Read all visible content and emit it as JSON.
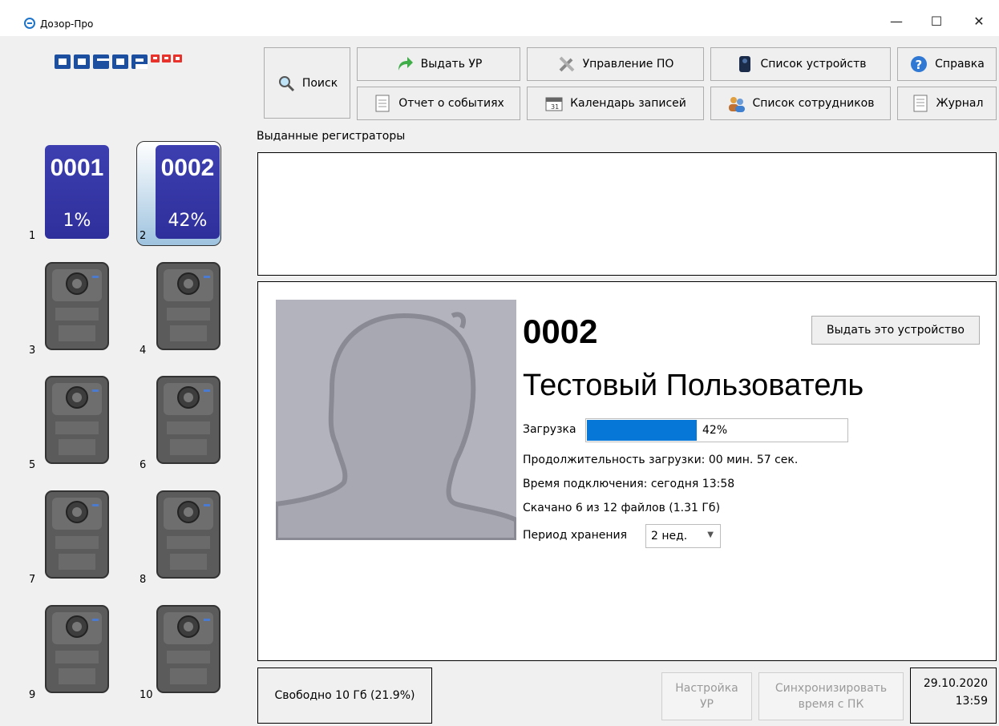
{
  "window": {
    "title": "Дозор-Про",
    "controls": {
      "minimize": "—",
      "maximize": "☐",
      "close": "✕"
    }
  },
  "logo": {
    "text_main": "DOZOR",
    "text_pro": "PRO",
    "colors": {
      "main": "#1c4fa0",
      "pro": "#e8322c"
    }
  },
  "toolbar": {
    "search": "Поиск",
    "issue": "Выдать УР",
    "events_report": "Отчет о событиях",
    "software": "Управление ПО",
    "calendar": "Календарь записей",
    "devices": "Список устройств",
    "employees": "Список сотрудников",
    "help": "Справка",
    "journal": "Журнал"
  },
  "devices": [
    {
      "slot": "1",
      "code": "0001",
      "charge": "1%"
    },
    {
      "slot": "2",
      "code": "0002",
      "charge": "42%"
    },
    {
      "slot": "3"
    },
    {
      "slot": "4"
    },
    {
      "slot": "5"
    },
    {
      "slot": "6"
    },
    {
      "slot": "7"
    },
    {
      "slot": "8"
    },
    {
      "slot": "9"
    },
    {
      "slot": "10"
    }
  ],
  "issued": {
    "label": "Выданные регистраторы"
  },
  "detail": {
    "device_code": "0002",
    "user_name": "Тестовый Пользователь",
    "issue_button": "Выдать это устройство",
    "download_label": "Загрузка",
    "download_progress": 0.42,
    "download_text": "42%",
    "duration": "Продолжительность загрузки: 00 мин. 57 сек.",
    "connected": "Время подключения: сегодня 13:58",
    "downloaded": "Скачано 6 из 12 файлов (1.31 Гб)",
    "retention_label": "Период хранения",
    "retention_value": "2 нед."
  },
  "footer": {
    "free_space": "Свободно 10 Гб (21.9%)",
    "settings_line1": "Настройка",
    "settings_line2": "УР",
    "sync_line1": "Синхронизировать",
    "sync_line2": "время с ПК",
    "date": "29.10.2020",
    "time": "13:59"
  },
  "colors": {
    "accent": "#0677d6",
    "device_active": "#3d3fb0"
  }
}
